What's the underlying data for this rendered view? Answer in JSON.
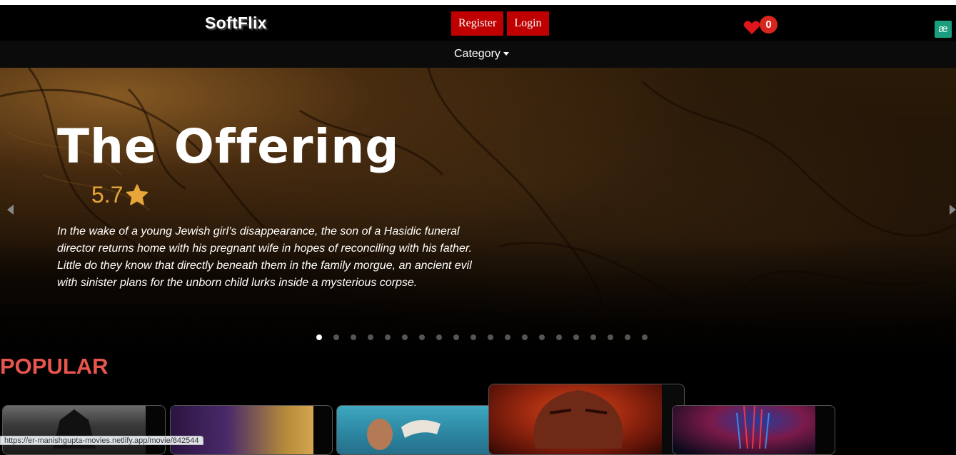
{
  "brand": "SoftFlix",
  "nav": {
    "register_label": "Register",
    "login_label": "Login",
    "favorites_count": "0",
    "extension_icon_text": "æ"
  },
  "subnav": {
    "category_label": "Category"
  },
  "hero": {
    "title": "The Offering",
    "rating": "5.7",
    "overview": "In the wake of a young Jewish girl’s disappearance, the son of a Hasidic funeral director returns home with his pregnant wife in hopes of reconciling with his father. Little do they know that directly beneath them in the family morgue, an ancient evil with sinister plans for the unborn child lurks inside a mysterious corpse.",
    "slide_count": 20,
    "active_slide": 1
  },
  "sections": {
    "popular_title": "POPULAR"
  },
  "status_bar": {
    "url": "https://er-manishgupta-movies.netlify.app/movie/842544"
  },
  "colors": {
    "accent_red": "#c00000",
    "rating_orange": "#e8a63a",
    "section_title": "#e8554e",
    "badge_red": "#d9261c"
  },
  "icons": {
    "heart": "heart-icon",
    "star": "star-icon",
    "prev": "chevron-left-icon",
    "next": "chevron-right-icon"
  }
}
